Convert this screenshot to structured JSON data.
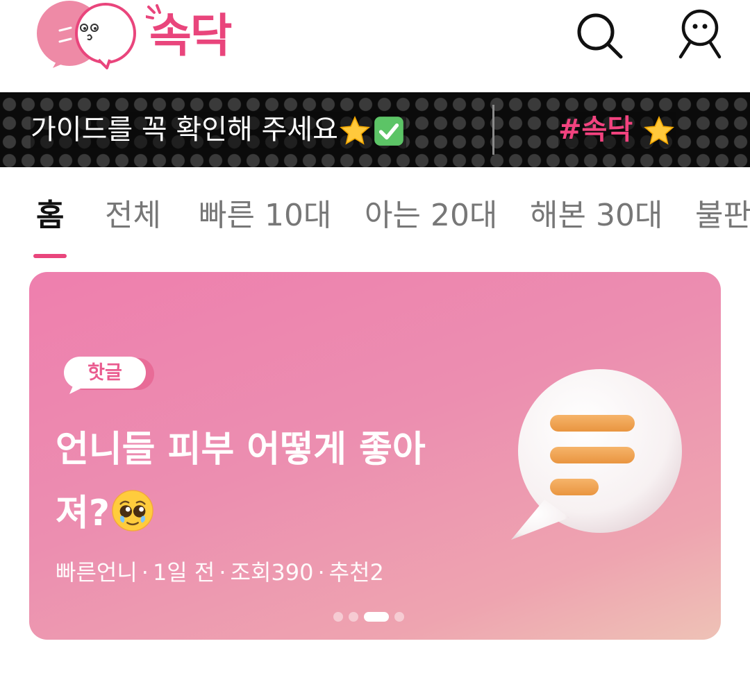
{
  "header": {
    "logo_text": "속닥",
    "icons": {
      "search": "search-icon",
      "profile": "profile-icon",
      "logo": "logo-mascot-icon"
    },
    "brand_color": "#e9457c"
  },
  "marquee": {
    "text": "가이드를 꼭 확인해 주세요",
    "hashtag": "#속닥",
    "emojis": [
      "star-icon",
      "check-mark-icon",
      "star-icon"
    ]
  },
  "tabs": [
    {
      "label": "홈",
      "active": true
    },
    {
      "label": "전체",
      "active": false
    },
    {
      "label": "빠른 10대",
      "active": false
    },
    {
      "label": "아는 20대",
      "active": false
    },
    {
      "label": "해본 30대",
      "active": false
    },
    {
      "label": "불판",
      "active": false
    }
  ],
  "hot_card": {
    "badge": "핫글",
    "title_line1": "언니들 피부 어떻게 좋아",
    "title_line2": "져?",
    "author": "빠른언니",
    "time": "1일 전",
    "views": "조회390",
    "likes": "추천2",
    "separator": "·",
    "pager": {
      "count": 4,
      "active_index": 2
    },
    "colors": {
      "gradient_start": "#ee7fae",
      "gradient_end": "#eec2b6",
      "accent": "#f0a65a"
    }
  }
}
